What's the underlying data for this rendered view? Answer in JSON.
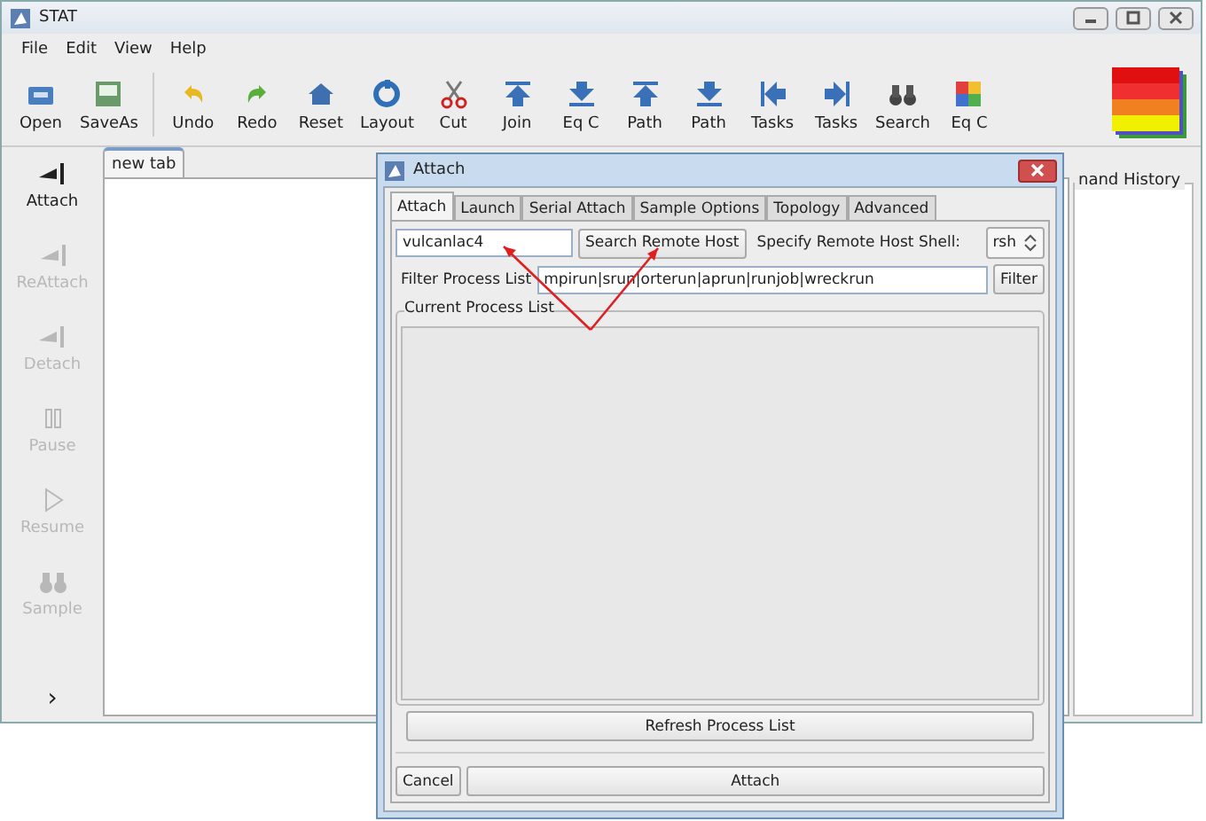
{
  "window": {
    "title": "STAT"
  },
  "menu": [
    "File",
    "Edit",
    "View",
    "Help"
  ],
  "toolbar": [
    {
      "label": "Open"
    },
    {
      "label": "SaveAs"
    },
    {
      "label": "Undo"
    },
    {
      "label": "Redo"
    },
    {
      "label": "Reset"
    },
    {
      "label": "Layout"
    },
    {
      "label": "Cut"
    },
    {
      "label": "Join"
    },
    {
      "label": "Eq C"
    },
    {
      "label": "Path"
    },
    {
      "label": "Path"
    },
    {
      "label": "Tasks"
    },
    {
      "label": "Tasks"
    },
    {
      "label": "Search"
    },
    {
      "label": "Eq C"
    }
  ],
  "sidebar": {
    "items": [
      {
        "label": "Attach",
        "disabled": false
      },
      {
        "label": "ReAttach",
        "disabled": true
      },
      {
        "label": "Detach",
        "disabled": true
      },
      {
        "label": "Pause",
        "disabled": true
      },
      {
        "label": "Resume",
        "disabled": true
      },
      {
        "label": "Sample",
        "disabled": true
      }
    ],
    "expand": "›"
  },
  "tabs": [
    {
      "label": "new tab",
      "selected": true
    }
  ],
  "side_panel": {
    "title": "nand History"
  },
  "dialog": {
    "title": "Attach",
    "tabs": [
      {
        "label": "Attach",
        "selected": true
      },
      {
        "label": "Launch",
        "selected": false
      },
      {
        "label": "Serial Attach",
        "selected": false
      },
      {
        "label": "Sample Options",
        "selected": false
      },
      {
        "label": "Topology",
        "selected": false
      },
      {
        "label": "Advanced",
        "selected": false
      }
    ],
    "host": {
      "value": "vulcanlac4"
    },
    "search_button": "Search Remote Host",
    "shell_label": "Specify Remote Host Shell:",
    "shell": {
      "value": "rsh"
    },
    "filter_label": "Filter Process List",
    "filter": {
      "value": "mpirun|srun|orterun|aprun|runjob|wreckrun"
    },
    "filter_button": "Filter",
    "process_list_title": "Current Process List",
    "refresh_button": "Refresh Process List",
    "cancel_button": "Cancel",
    "attach_button": "Attach"
  }
}
